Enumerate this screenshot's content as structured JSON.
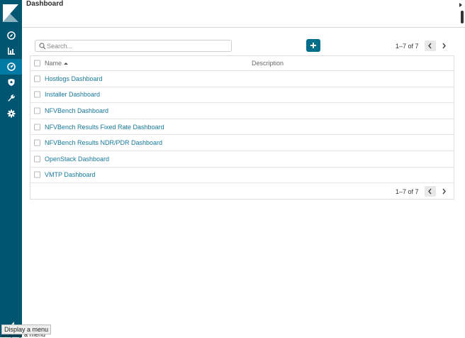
{
  "header": {
    "title": "Dashboard"
  },
  "toolbar": {
    "search_placeholder": "Search...",
    "search_value": "",
    "add_label": "+"
  },
  "pager": {
    "top_text": "1–7 of 7",
    "bottom_text": "1–7 of 7"
  },
  "table": {
    "columns": {
      "name": "Name",
      "description": "Description"
    },
    "sort": "ascending",
    "rows": [
      {
        "name": "Hostlogs Dashboard",
        "description": ""
      },
      {
        "name": "Installer Dashboard",
        "description": ""
      },
      {
        "name": "NFVBench Dashboard",
        "description": ""
      },
      {
        "name": "NFVBench Results Fixed Rate Dashboard",
        "description": ""
      },
      {
        "name": "NFVBench Results NDR/PDR Dashboard",
        "description": ""
      },
      {
        "name": "OpenStack Dashboard",
        "description": ""
      },
      {
        "name": "VMTP Dashboard",
        "description": ""
      }
    ]
  },
  "sidebar": {
    "items": [
      {
        "icon": "compass-icon",
        "active": false
      },
      {
        "icon": "bar-chart-icon",
        "active": false
      },
      {
        "icon": "dashboard-icon",
        "active": true
      },
      {
        "icon": "shield-icon",
        "active": false
      },
      {
        "icon": "wrench-icon",
        "active": false
      },
      {
        "icon": "gear-icon",
        "active": false
      }
    ]
  },
  "tooltip": {
    "text": "Display a menu",
    "shadow_text": "Display a menu"
  },
  "colors": {
    "sidebar": "#005571",
    "sidebar_active": "#0079a5",
    "accent": "#006e8a",
    "link": "#16799b"
  }
}
